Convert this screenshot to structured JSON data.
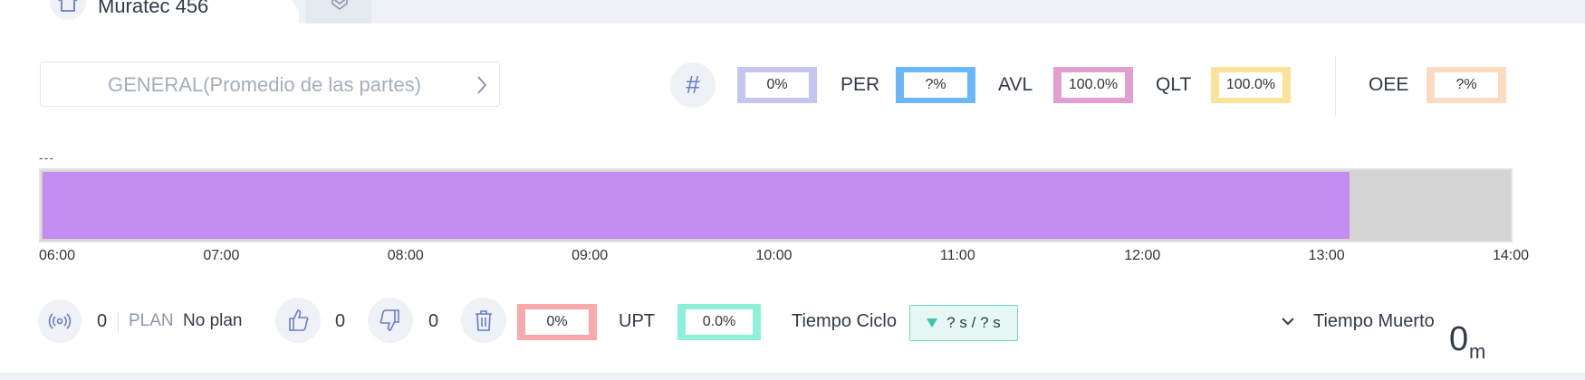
{
  "header": {
    "machine_name": "Muratec 456",
    "home_icon": "home-icon",
    "tab_icon": "hexagon-icon"
  },
  "selector": {
    "label": "GENERAL(Promedio de las partes)",
    "chevron_icon": "chevron-right-icon"
  },
  "metrics": {
    "hash_symbol": "#",
    "count_value": "0%",
    "per": {
      "label": "PER",
      "value": "?%",
      "color": "#6cb6fa"
    },
    "avl": {
      "label": "AVL",
      "value": "100.0%",
      "color": "#e29ed0"
    },
    "qlt": {
      "label": "QLT",
      "value": "100.0%",
      "color": "#fbe39a"
    },
    "oee": {
      "label": "OEE",
      "value": "?%",
      "color": "#fbdcc0"
    },
    "count_color": "#c5c5ef"
  },
  "timeline": {
    "placeholder": "---",
    "ticks": [
      "06:00",
      "07:00",
      "08:00",
      "09:00",
      "10:00",
      "11:00",
      "12:00",
      "13:00",
      "14:00"
    ],
    "fill_fraction": 0.891,
    "fill_color": "#c38cf1",
    "track_color": "#d4d4d4"
  },
  "footer": {
    "signal_icon": "signal-icon",
    "signal_count": "0",
    "plan_label": "PLAN",
    "plan_value": "No plan",
    "good_icon": "thumbs-up-icon",
    "good_count": "0",
    "bad_icon": "thumbs-down-icon",
    "bad_count": "0",
    "trash_icon": "trash-icon",
    "scrap_value": "0%",
    "scrap_color": "#f8a9a9",
    "upt_label": "UPT",
    "upt_value": "0.0%",
    "upt_color": "#8ef0d8",
    "ciclo_label": "Tiempo Ciclo",
    "ciclo_value": "? s / ? s",
    "muerto_label": "Tiempo Muerto",
    "muerto_value": "0",
    "muerto_unit": "m"
  }
}
